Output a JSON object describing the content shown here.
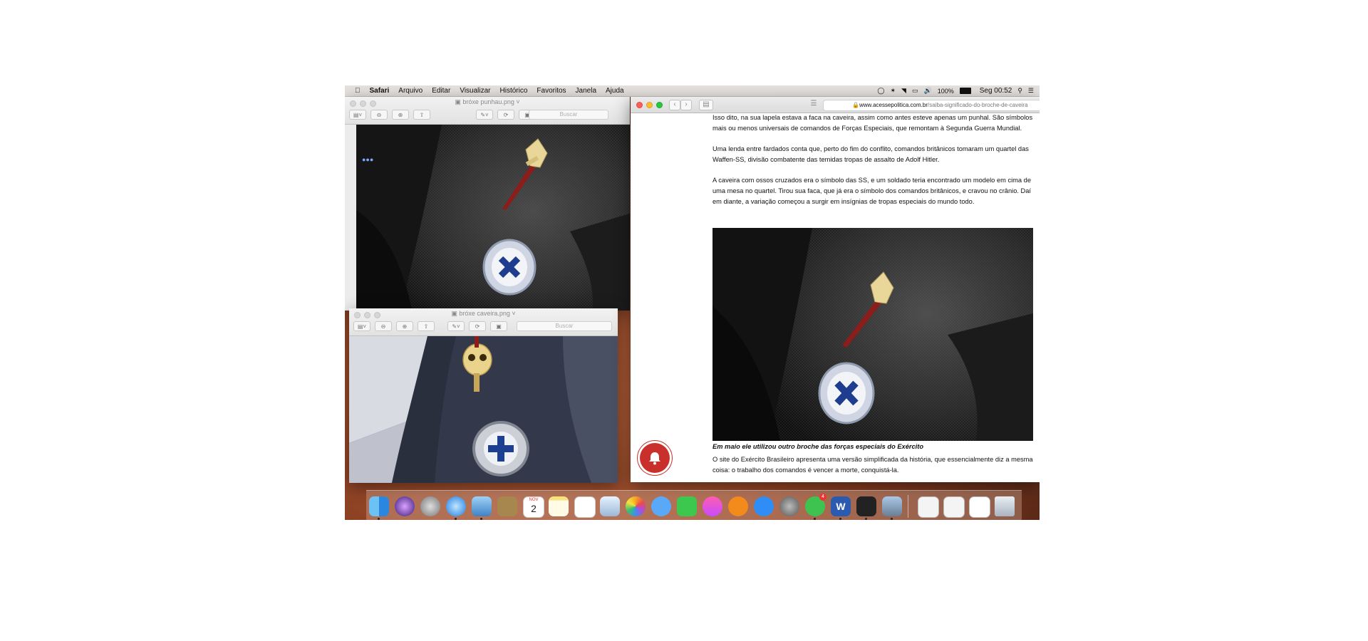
{
  "menubar": {
    "apple_icon": "apple-icon",
    "app_name": "Safari",
    "items": [
      "Arquivo",
      "Editar",
      "Visualizar",
      "Histórico",
      "Favoritos",
      "Janela",
      "Ajuda"
    ],
    "battery": "100%",
    "clock": "Seg 00:52"
  },
  "preview_top": {
    "title": "bróxe punhau.png",
    "search_placeholder": "Buscar"
  },
  "preview_bottom": {
    "title": "bróxe caveira.png",
    "search_placeholder": "Buscar"
  },
  "safari": {
    "url_host": "www.acessepolitica.com.br",
    "url_path": "/saiba-significado-do-broche-de-caveira",
    "paragraphs": [
      "Isso dito, na sua lapela estava a faca na caveira, assim como antes esteve apenas um punhal. São símbolos mais ou menos universais de comandos de Forças Especiais, que remontam à Segunda Guerra Mundial.",
      "Uma lenda entre fardados conta que, perto do fim do conflito, comandos britânicos tomaram um quartel das Waffen-SS, divisão combatente das temidas tropas de assalto de Adolf Hitler.",
      "A caveira com ossos cruzados era o símbolo das SS, e um soldado teria encontrado um modelo em cima de uma mesa no quartel. Tirou sua faca, que já era o símbolo dos comandos britânicos, e cravou no crânio. Daí em diante, a variação começou a surgir em insígnias de tropas especiais do mundo todo."
    ],
    "caption": "Em maio ele utilizou outro broche das forças especiais do Exército",
    "after_text": "O site do Exército Brasileiro apresenta uma versão simplificada da história, que essencialmente diz a mesma coisa: o trabalho dos comandos é vencer a morte, conquistá-la.",
    "bell_icon": "notification-bell-icon"
  },
  "calendar": {
    "day": "2",
    "month": "NOV"
  },
  "whatsapp_badge": "4",
  "dock_icons": [
    "finder-icon",
    "siri-icon",
    "launchpad-icon",
    "safari-icon",
    "preview-icon",
    "notes-book-icon",
    "calendar-icon",
    "notes-icon",
    "reminders-icon",
    "photos-preview-icon",
    "photos-icon",
    "messages-icon",
    "facetime-icon",
    "itunes-icon",
    "ibooks-icon",
    "app-store-icon",
    "system-preferences-icon",
    "whatsapp-icon",
    "word-icon",
    "terminal-icon",
    "image-capture-icon",
    "window-1-icon",
    "window-2-icon",
    "document-icon",
    "trash-icon"
  ]
}
